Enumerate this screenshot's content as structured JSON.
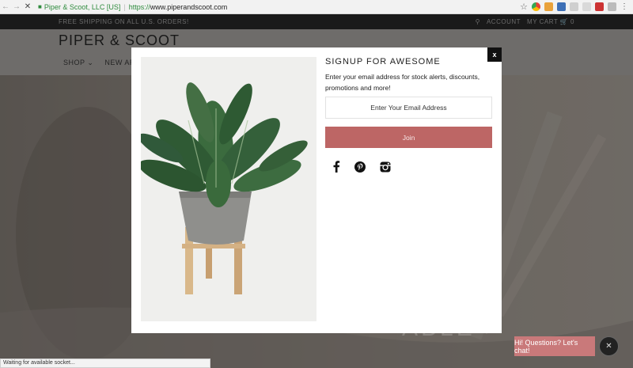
{
  "browser": {
    "site_identity": "Piper & Scoot, LLC [US]",
    "url_scheme": "https://",
    "url_host": "www.piperandscoot.com"
  },
  "site": {
    "announcement": "FREE SHIPPING ON ALL U.S. ORDERS!",
    "account_label": "ACCOUNT",
    "cart_label": "MY CART",
    "cart_count": "0",
    "logo": "PIPER & SCOOT",
    "menu": [
      "SHOP",
      "NEW AR"
    ],
    "hero_text": "ABLE >"
  },
  "modal": {
    "close_label": "x",
    "title": "SIGNUP FOR AWESOME",
    "description": "Enter your email address for stock alerts, discounts, promotions and more!",
    "email_placeholder": "Enter Your Email Address",
    "join_label": "Join",
    "social_icons": [
      "facebook-icon",
      "pinterest-icon",
      "instagram-icon"
    ]
  },
  "chat": {
    "label": "Hi! Questions? Let's chat!"
  },
  "status_bar": "Waiting for available socket...",
  "colors": {
    "join_button": "#bd6665",
    "chat_button": "#c9797a",
    "secure_green": "#2e8b3d"
  }
}
